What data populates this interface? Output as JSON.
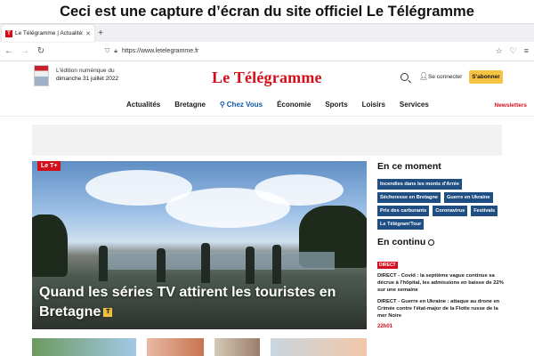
{
  "caption": "Ceci est une capture d’écran du site officiel Le Télégramme",
  "browser": {
    "tab_title": "Le Télégramme | Actualités et in",
    "tab_favicon": "T",
    "url": "https://www.letelegramme.fr"
  },
  "header": {
    "edition_line1": "L'édition numérique du",
    "edition_line2": "dimanche 31 juillet 2022",
    "logo": "Le Télégramme",
    "connect": "Se connecter",
    "subscribe": "S'abonner"
  },
  "menu": {
    "items": [
      "Actualités",
      "Bretagne",
      "Chez Vous",
      "Économie",
      "Sports",
      "Loisirs",
      "Services"
    ],
    "newsletters": "Newsletters"
  },
  "hero": {
    "badge": "Le T+",
    "headline": "Quand les séries TV attirent les touristes en Bretagne",
    "premium_badge": "T"
  },
  "side": {
    "moment_title": "En ce moment",
    "tags": [
      "Incendies dans les monts d'Arrée",
      "Sécheresse en Bretagne",
      "Guerre en Ukraine",
      "Prix des carburants",
      "Coronavirus",
      "Festivals",
      "Le Télégram'Tour"
    ],
    "continu_title": "En continu",
    "direct_label": "DIRECT",
    "news": [
      "DIRECT - Covid : la septième vague continue sa décrue à l'hôpital, les admissions en baisse de 22% sur une semaine",
      "DIRECT - Guerre en Ukraine : attaque au drone en Crimée contre l'état-major de la Flotte russe de la mer Noire"
    ],
    "time": "22h01"
  },
  "colors": {
    "brand_red": "#d40d1a",
    "tag_blue": "#1f4f82",
    "subscribe_yellow": "#f7c342"
  }
}
